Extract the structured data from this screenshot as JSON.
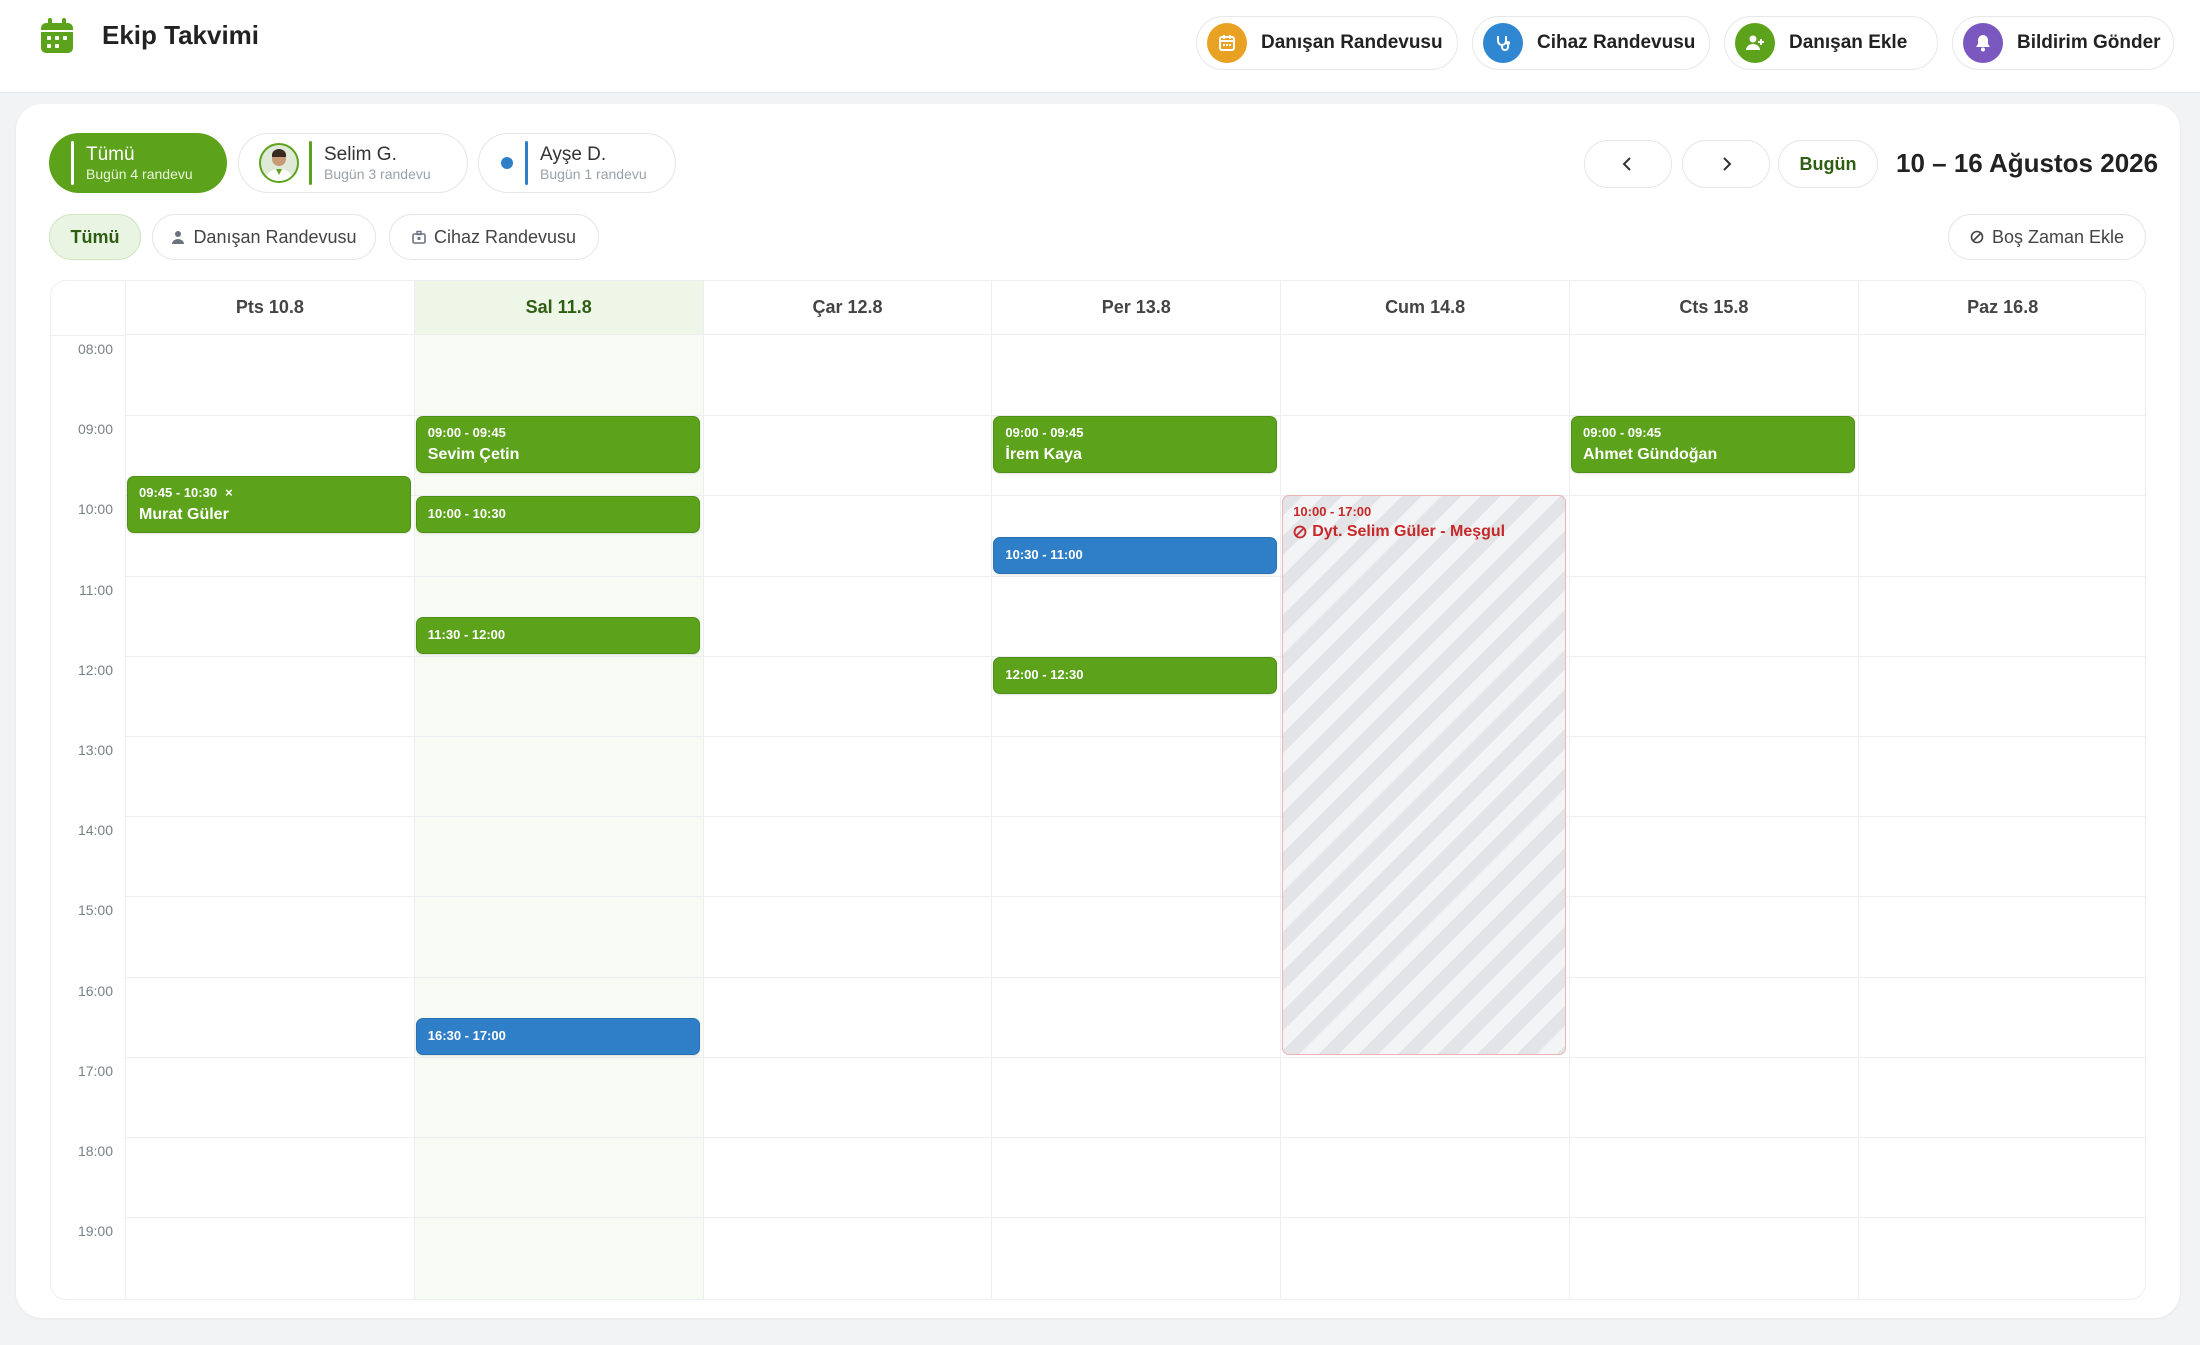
{
  "header": {
    "title": "Ekip Takvimi",
    "actions": [
      {
        "label": "Danışan Randevusu",
        "icon": "calendar-icon",
        "color": "#e9a123"
      },
      {
        "label": "Cihaz Randevusu",
        "icon": "stethoscope-icon",
        "color": "#2f86d1"
      },
      {
        "label": "Danışan Ekle",
        "icon": "user-plus-icon",
        "color": "#5ca31b"
      },
      {
        "label": "Bildirim Gönder",
        "icon": "bell-icon",
        "color": "#7b57c0"
      }
    ]
  },
  "staff": [
    {
      "name": "Tümü",
      "sub": "Bugün 4 randevu"
    },
    {
      "name": "Selim G.",
      "sub": "Bugün 3 randevu"
    },
    {
      "name": "Ayşe D.",
      "sub": "Bugün 1 randevu"
    }
  ],
  "nav": {
    "today_label": "Bugün",
    "range": "10 – 16 Ağustos 2026"
  },
  "filters": {
    "all": "Tümü",
    "client": "Danışan Randevusu",
    "device": "Cihaz Randevusu",
    "add_busy": "Boş Zaman Ekle"
  },
  "days": [
    "Pts 10.8",
    "Sal 11.8",
    "Çar 12.8",
    "Per 13.8",
    "Cum 14.8",
    "Cts 15.8",
    "Paz 16.8"
  ],
  "today_index": 1,
  "hours": [
    "08:00",
    "09:00",
    "10:00",
    "11:00",
    "12:00",
    "13:00",
    "14:00",
    "15:00",
    "16:00",
    "17:00",
    "18:00",
    "19:00"
  ],
  "colors": {
    "client": "#5ca31b",
    "device": "#2f7fc8",
    "busy": "#c62828",
    "today_bg": "#f7fbf4"
  },
  "events": [
    {
      "day": 0,
      "start": "09:45",
      "end": "10:30",
      "time": "09:45 - 10:30",
      "name": "Murat Güler",
      "type": "client",
      "cancel": "×"
    },
    {
      "day": 1,
      "start": "09:00",
      "end": "09:45",
      "time": "09:00 - 09:45",
      "name": "Sevim Çetin",
      "type": "client"
    },
    {
      "day": 1,
      "start": "10:00",
      "end": "10:30",
      "time": "10:00 - 10:30",
      "name": "",
      "type": "client"
    },
    {
      "day": 1,
      "start": "11:30",
      "end": "12:00",
      "time": "11:30 - 12:00",
      "name": "",
      "type": "client"
    },
    {
      "day": 1,
      "start": "16:30",
      "end": "17:00",
      "time": "16:30 - 17:00",
      "name": "",
      "type": "device"
    },
    {
      "day": 3,
      "start": "09:00",
      "end": "09:45",
      "time": "09:00 - 09:45",
      "name": "İrem Kaya",
      "type": "client"
    },
    {
      "day": 3,
      "start": "10:30",
      "end": "11:00",
      "time": "10:30 - 11:00",
      "name": "",
      "type": "device"
    },
    {
      "day": 3,
      "start": "12:00",
      "end": "12:30",
      "time": "12:00 - 12:30",
      "name": "",
      "type": "client"
    },
    {
      "day": 5,
      "start": "09:00",
      "end": "09:45",
      "time": "09:00 - 09:45",
      "name": "Ahmet Gündoğan",
      "type": "client"
    }
  ],
  "busy": [
    {
      "day": 4,
      "start": "10:00",
      "end": "17:00",
      "time": "10:00 - 17:00",
      "label": "Dyt. Selim Güler - Meşgul"
    }
  ]
}
